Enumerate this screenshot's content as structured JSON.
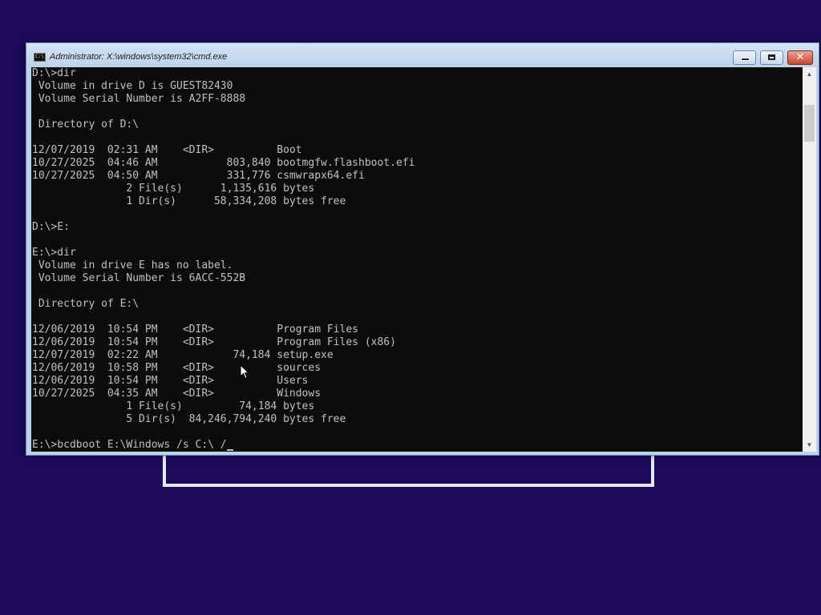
{
  "window": {
    "title": "Administrator: X:\\windows\\system32\\cmd.exe",
    "icon_label": "C:\\",
    "controls": {
      "minimize": "minimize-icon",
      "maximize": "maximize-icon",
      "close": "✕"
    }
  },
  "console": {
    "lines": [
      "D:\\>dir",
      " Volume in drive D is GUEST82430",
      " Volume Serial Number is A2FF-8888",
      "",
      " Directory of D:\\",
      "",
      "12/07/2019  02:31 AM    <DIR>          Boot",
      "10/27/2025  04:46 AM           803,840 bootmgfw.flashboot.efi",
      "10/27/2025  04:50 AM           331,776 csmwrapx64.efi",
      "               2 File(s)      1,135,616 bytes",
      "               1 Dir(s)      58,334,208 bytes free",
      "",
      "D:\\>E:",
      "",
      "E:\\>dir",
      " Volume in drive E has no label.",
      " Volume Serial Number is 6ACC-552B",
      "",
      " Directory of E:\\",
      "",
      "12/06/2019  10:54 PM    <DIR>          Program Files",
      "12/06/2019  10:54 PM    <DIR>          Program Files (x86)",
      "12/07/2019  02:22 AM            74,184 setup.exe",
      "12/06/2019  10:58 PM    <DIR>          sources",
      "12/06/2019  10:54 PM    <DIR>          Users",
      "10/27/2025  04:35 AM    <DIR>          Windows",
      "               1 File(s)         74,184 bytes",
      "               5 Dir(s)  84,246,794,240 bytes free",
      ""
    ],
    "current_input": "E:\\>bcdboot E:\\Windows /s C:\\ /"
  },
  "scrollbar": {
    "up_arrow": "▲",
    "down_arrow": "▼"
  },
  "colors": {
    "desktop": "#1c0a5c",
    "console_bg": "#0c0c0c",
    "console_text": "#c0c0c0"
  }
}
